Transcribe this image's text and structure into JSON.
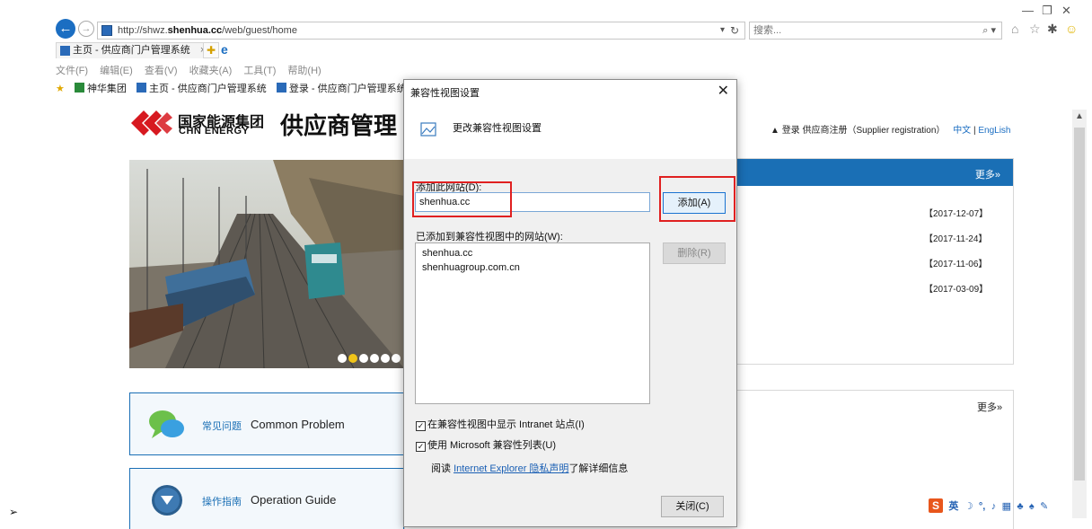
{
  "browser": {
    "url_prefix": "http://shwz.",
    "url_domain": "shenhua.cc",
    "url_suffix": "/web/guest/home",
    "search_placeholder": "搜索...",
    "tab_title": "主页 - 供应商门户管理系统",
    "tab_close": "×",
    "menu": [
      "文件(F)",
      "编辑(E)",
      "查看(V)",
      "收藏夹(A)",
      "工具(T)",
      "帮助(H)"
    ],
    "favorites": [
      "神华集团",
      "主页 - 供应商门户管理系统",
      "登录 - 供应商门户管理系统"
    ],
    "win_minimize": "—",
    "win_restore": "❐",
    "win_close": "✕"
  },
  "page": {
    "logo_cn": "国家能源集团",
    "logo_en": "CHN ENERGY",
    "site_title": "供应商管理",
    "login_link": "登录",
    "register_link": "供应商注册（Supplier registration）",
    "lang_cn": "中文",
    "lang_sep": "|",
    "lang_en": "EngLish",
    "news_more": "更多»",
    "news_dates": [
      "【2017-12-07】",
      "【2017-11-24】",
      "【2017-11-06】",
      "【2017-03-09】"
    ],
    "more2": "更多»",
    "box1_cn": "常见问题",
    "box1_en": "Common Problem",
    "box2_cn": "操作指南",
    "box2_en": "Operation Guide",
    "ime_label": "英"
  },
  "dialog": {
    "title": "兼容性视图设置",
    "close_glyph": "✕",
    "header": "更改兼容性视图设置",
    "add_label": "添加此网站(D):",
    "add_value": "shenhua.cc",
    "add_button": "添加(A)",
    "list_label": "已添加到兼容性视图中的网站(W):",
    "sites": [
      "shenhua.cc",
      "shenhuagroup.com.cn"
    ],
    "remove_button": "删除(R)",
    "check_intranet": "在兼容性视图中显示 Intranet 站点(I)",
    "check_ms_list": "使用 Microsoft 兼容性列表(U)",
    "privacy_prefix": "阅读",
    "privacy_link": "Internet Explorer 隐私声明",
    "privacy_suffix": "了解详细信息",
    "close_button": "关闭(C)",
    "checkbox_intranet_checked": true,
    "checkbox_ms_checked": true
  },
  "colors": {
    "brand_blue": "#1a6fb5",
    "highlight_red": "#e02020",
    "ime_orange": "#e8561c"
  }
}
